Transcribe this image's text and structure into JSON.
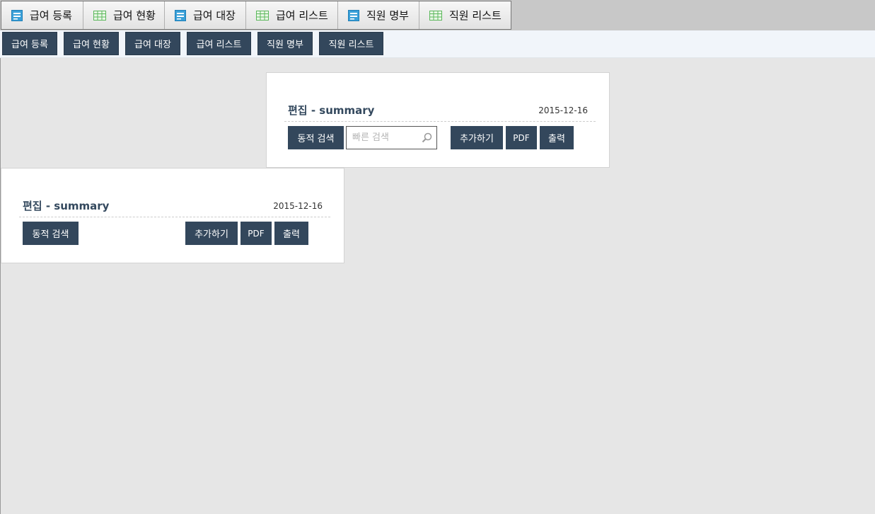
{
  "tabs": [
    {
      "label": "급여 등록",
      "icon": "form-icon"
    },
    {
      "label": "급여 현황",
      "icon": "grid-icon"
    },
    {
      "label": "급여 대장",
      "icon": "form-icon"
    },
    {
      "label": "급여 리스트",
      "icon": "grid-icon"
    },
    {
      "label": "직원 명부",
      "icon": "form-icon"
    },
    {
      "label": "직원 리스트",
      "icon": "grid-icon"
    }
  ],
  "nav_buttons": [
    "급여 등록",
    "급여 현황",
    "급여 대장",
    "급여 리스트",
    "직원 명부",
    "직원 리스트"
  ],
  "panel_top": {
    "title": "편집 - summary",
    "date": "2015-12-16",
    "dynamic_search": "동적 검색",
    "search_placeholder": "빠른 검색",
    "add": "추가하기",
    "pdf": "PDF",
    "print": "출력"
  },
  "panel_bottom": {
    "title": "편집 - summary",
    "date": "2015-12-16",
    "dynamic_search": "동적 검색",
    "add": "추가하기",
    "pdf": "PDF",
    "print": "출력"
  },
  "colors": {
    "button": "#33475c",
    "title": "#34495e",
    "form_icon": "#3aa0d8",
    "grid_icon": "#5cb85c"
  }
}
